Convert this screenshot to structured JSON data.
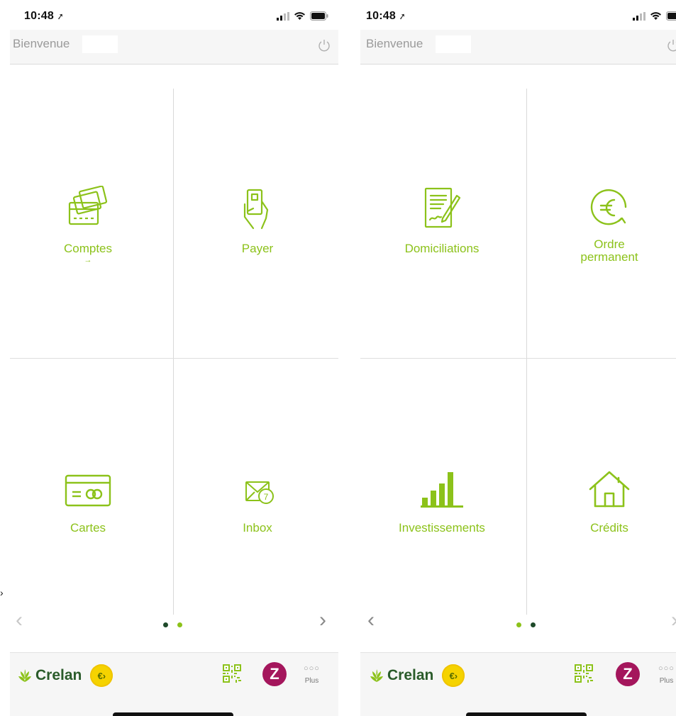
{
  "status_bar": {
    "time": "10:48"
  },
  "header": {
    "welcome": "Bienvenue"
  },
  "screens": [
    {
      "tiles": [
        {
          "label": "Comptes",
          "sub": "→",
          "icon": "credit-cards-icon"
        },
        {
          "label": "Payer",
          "icon": "hand-phone-icon"
        },
        {
          "label": "Cartes",
          "icon": "bank-card-icon"
        },
        {
          "label": "Inbox",
          "icon": "envelope-badge-icon",
          "badge": "7"
        }
      ]
    },
    {
      "tiles": [
        {
          "label": "Domiciliations",
          "icon": "signed-document-icon"
        },
        {
          "label_line1": "Ordre",
          "label_line2": "permanent",
          "icon": "euro-cycle-icon"
        },
        {
          "label": "Investissements",
          "icon": "bar-chart-icon"
        },
        {
          "label": "Crédits",
          "icon": "house-icon"
        }
      ]
    }
  ],
  "navigation": {
    "prev": "‹",
    "next": "›"
  },
  "footer": {
    "brand": "Crelan",
    "euro_badge": "€›",
    "zoomit": "Z",
    "more_dots": "○○○",
    "more_label": "Plus"
  },
  "colors": {
    "accent_green": "#8cc21a",
    "brand_green": "#2a5b2a",
    "dot_active": "#1e4a2a",
    "dot_inactive": "#8cc21a",
    "zoomit_purple": "#a4165c",
    "euro_yellow": "#f5d300"
  }
}
